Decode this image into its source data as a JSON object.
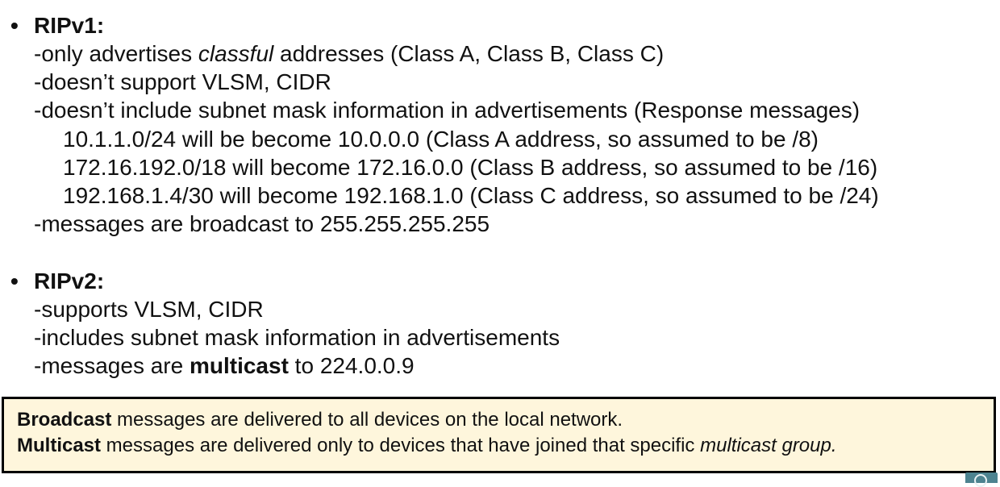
{
  "ripv1": {
    "bullet": "•",
    "title": "RIPv1:",
    "line1_pre": "-only advertises ",
    "line1_em": "classful",
    "line1_post": " addresses (Class A, Class B, Class C)",
    "line2": "-doesn’t support VLSM, CIDR",
    "line3": "-doesn’t include subnet mask information in advertisements (Response messages)",
    "examples": [
      "10.1.1.0/24 will be become 10.0.0.0 (Class A address, so assumed to be /8)",
      "172.16.192.0/18 will become 172.16.0.0 (Class B address, so assumed to be /16)",
      "192.168.1.4/30 will become 192.168.1.0 (Class C address, so assumed to be /24)"
    ],
    "line4": "-messages are broadcast to 255.255.255.255"
  },
  "ripv2": {
    "bullet": "•",
    "title": "RIPv2:",
    "line1": "-supports VLSM, CIDR",
    "line2": "-includes subnet mask information in advertisements",
    "line3_pre": "-messages are ",
    "line3_bold": "multicast",
    "line3_post": " to 224.0.0.9"
  },
  "callout": {
    "line1_bold": "Broadcast",
    "line1_rest": " messages are delivered to all devices on the local network.",
    "line2_bold": "Multicast",
    "line2_rest": " messages are delivered only to devices that have joined that specific ",
    "line2_em": "multicast group."
  },
  "corner_badge": {
    "icon": "logo-icon",
    "color": "#4d8390"
  }
}
